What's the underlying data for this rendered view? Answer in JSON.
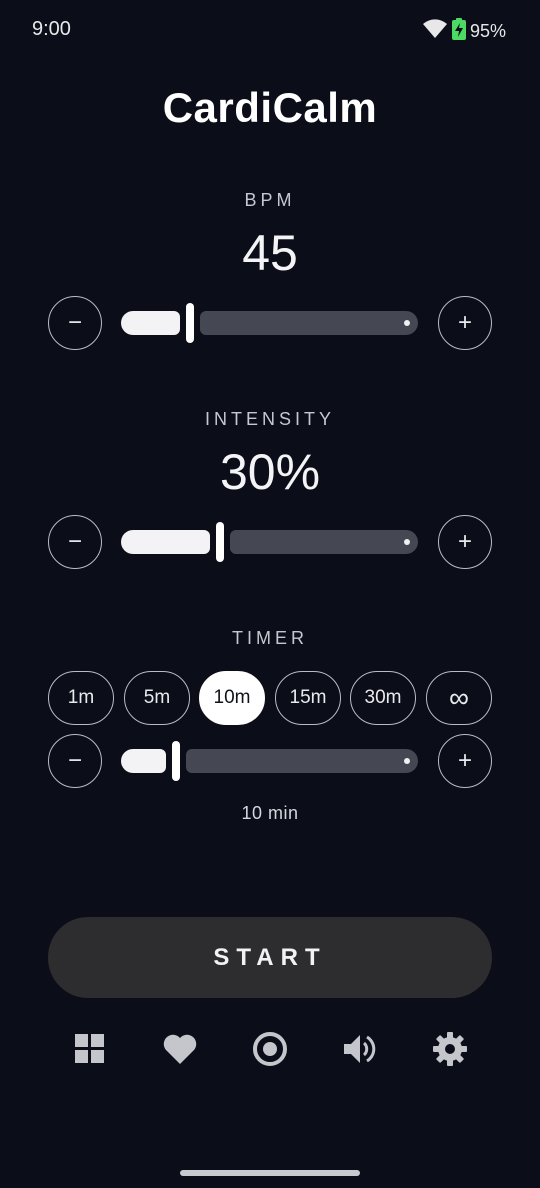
{
  "status_bar": {
    "time": "9:00",
    "battery_percent": "95%",
    "icons": [
      "wifi-icon",
      "battery-charging-icon"
    ]
  },
  "app": {
    "title": "CardiCalm"
  },
  "bpm": {
    "label": "BPM",
    "value": "45",
    "decrement_label": "−",
    "increment_label": "+",
    "slider_fraction": 0.2
  },
  "intensity": {
    "label": "INTENSITY",
    "value": "30%",
    "decrement_label": "−",
    "increment_label": "+",
    "slider_fraction": 0.3
  },
  "timer": {
    "label": "TIMER",
    "presets": [
      {
        "label": "1m",
        "selected": false
      },
      {
        "label": "5m",
        "selected": false
      },
      {
        "label": "10m",
        "selected": true
      },
      {
        "label": "15m",
        "selected": false
      },
      {
        "label": "30m",
        "selected": false
      },
      {
        "label": "∞",
        "selected": false
      }
    ],
    "decrement_label": "−",
    "increment_label": "+",
    "readout": "10 min",
    "slider_fraction": 0.15
  },
  "start_button": {
    "label": "START"
  },
  "bottom_nav": {
    "items": [
      "dashboard-icon",
      "heart-icon",
      "target-icon",
      "volume-icon",
      "settings-icon"
    ]
  },
  "colors": {
    "background": "#0b0e18",
    "track": "#454853",
    "fill": "#f3f3f5",
    "start_button": "#2d2d2f",
    "nav_icon": "#c4c6cc"
  }
}
